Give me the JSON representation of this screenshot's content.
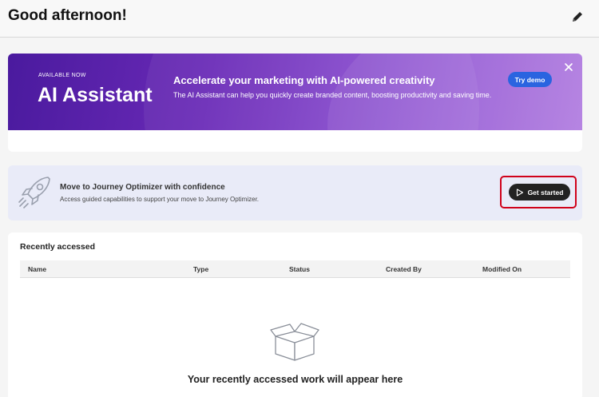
{
  "header": {
    "greeting": "Good afternoon!",
    "edit_icon": "pencil-icon"
  },
  "ai_banner": {
    "eyebrow": "AVAILABLE NOW",
    "title": "AI Assistant",
    "heading": "Accelerate your marketing with AI-powered creativity",
    "description": "The AI Assistant can help you quickly create branded content, boosting productivity and saving time.",
    "cta_label": "Try demo",
    "close_icon": "close-icon",
    "accent_color": "#2a64e0",
    "gradient_start": "#4a1a9e",
    "gradient_end": "#b07be0"
  },
  "journey_card": {
    "icon": "rocket-icon",
    "title": "Move to Journey Optimizer with confidence",
    "subtitle": "Access guided capabilities to support your move to Journey Optimizer.",
    "cta_label": "Get started",
    "cta_icon": "play-icon",
    "highlight_color": "#d0021b"
  },
  "recent": {
    "title": "Recently accessed",
    "columns": [
      "Name",
      "Type",
      "Status",
      "Created By",
      "Modified On"
    ],
    "empty_icon": "open-box-icon",
    "empty_message": "Your recently accessed work will appear here"
  }
}
